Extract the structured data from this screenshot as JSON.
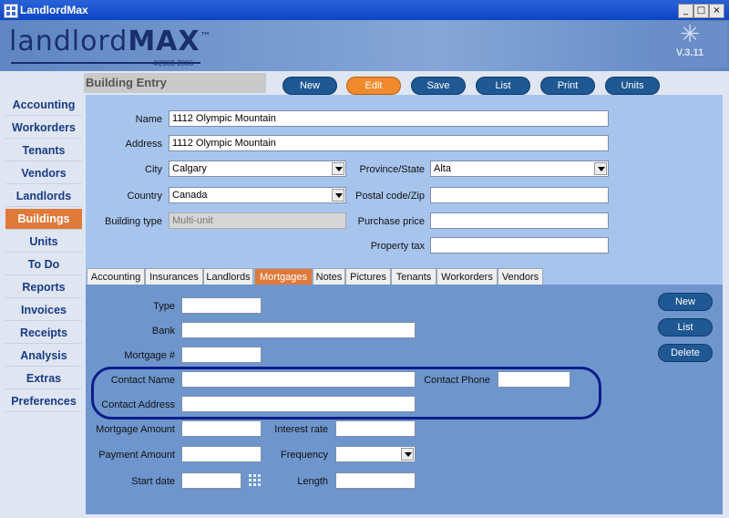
{
  "window": {
    "title": "LandlordMax",
    "minimize": "_",
    "maximize": "□",
    "close": "×"
  },
  "header": {
    "logo_light": "landlord",
    "logo_bold": "MAX",
    "logo_tm": "™",
    "copyright": "©2003-2006",
    "version": "V.3.11",
    "star": "✳"
  },
  "sidebar": {
    "items": [
      "Accounting",
      "Workorders",
      "Tenants",
      "Vendors",
      "Landlords",
      "Buildings",
      "Units",
      "To Do",
      "Reports",
      "Invoices",
      "Receipts",
      "Analysis",
      "Extras",
      "Preferences"
    ],
    "active": "Buildings"
  },
  "section": {
    "title": "Building Entry"
  },
  "toolbar": {
    "new": "New",
    "edit": "Edit",
    "save": "Save",
    "list": "List",
    "print": "Print",
    "units": "Units"
  },
  "building": {
    "name_label": "Name",
    "name": "1112 Olympic Mountain",
    "address_label": "Address",
    "address": "1112 Olympic Mountain",
    "city_label": "City",
    "city": "Calgary",
    "country_label": "Country",
    "country": "Canada",
    "building_type_label": "Building type",
    "building_type": "Multi-unit",
    "province_label": "Province/State",
    "province": "Alta",
    "postal_label": "Postal code/Zip",
    "postal": "",
    "purchase_label": "Purchase price",
    "purchase": "",
    "tax_label": "Property tax",
    "tax": ""
  },
  "tabs": [
    "Accounting",
    "Insurances",
    "Landlords",
    "Mortgages",
    "Notes",
    "Pictures",
    "Tenants",
    "Workorders",
    "Vendors"
  ],
  "active_tab": "Mortgages",
  "mortgage": {
    "type_label": "Type",
    "bank_label": "Bank",
    "number_label": "Mortgage #",
    "contact_name_label": "Contact Name",
    "contact_phone_label": "Contact Phone",
    "contact_address_label": "Contact Address",
    "amount_label": "Mortgage Amount",
    "interest_label": "Interest rate",
    "payment_label": "Payment Amount",
    "frequency_label": "Frequency",
    "start_label": "Start date",
    "length_label": "Length"
  },
  "sub_buttons": {
    "new": "New",
    "list": "List",
    "delete": "Delete"
  },
  "colors": {
    "accent": "#e07a3a",
    "button": "#1f5893",
    "highlight": "#0b1d8a"
  }
}
